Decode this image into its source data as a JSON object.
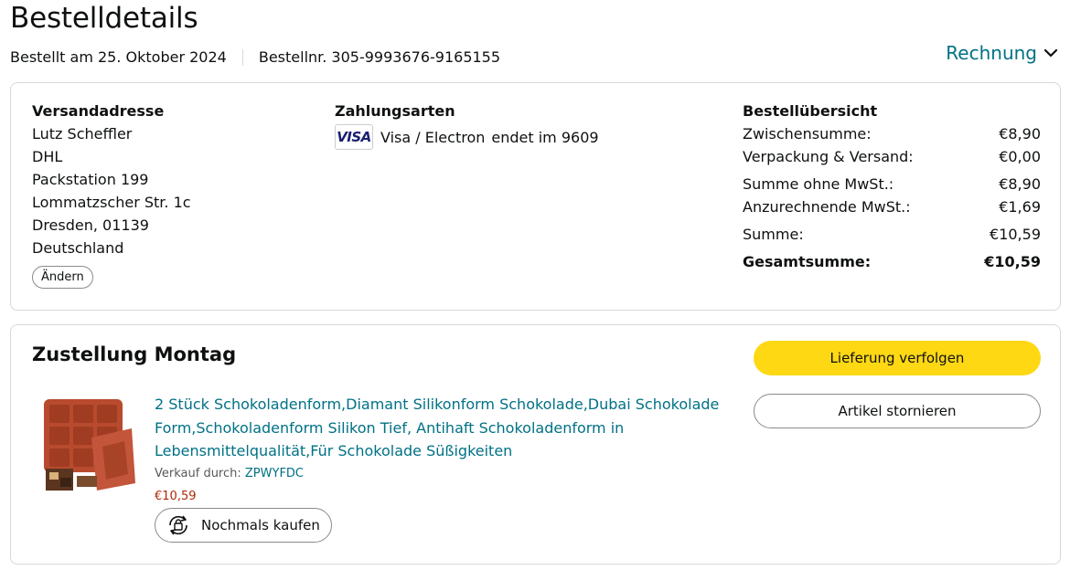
{
  "header": {
    "title": "Bestelldetails",
    "ordered_on": "Bestellt am 25. Oktober 2024",
    "order_number": "Bestellnr. 305-9993676-9165155",
    "invoice_label": "Rechnung"
  },
  "shipping": {
    "title": "Versandadresse",
    "lines": [
      "Lutz Scheffler",
      "DHL",
      "Packstation 199",
      "Lommatzscher Str. 1c",
      "Dresden, 01139",
      "Deutschland"
    ],
    "change_label": "Ändern"
  },
  "payment": {
    "title": "Zahlungsarten",
    "card_brand": "VISA",
    "card_type": "Visa / Electron",
    "ends": "endet im 9609"
  },
  "summary": {
    "title": "Bestellübersicht",
    "rows": [
      {
        "label": "Zwischensumme:",
        "value": "€8,90"
      },
      {
        "label": "Verpackung & Versand:",
        "value": "€0,00"
      },
      {
        "label": "Summe ohne MwSt.:",
        "value": "€8,90"
      },
      {
        "label": "Anzurechnende MwSt.:",
        "value": "€1,69"
      },
      {
        "label": "Summe:",
        "value": "€10,59"
      },
      {
        "label": "Gesamtsumme:",
        "value": "€10,59"
      }
    ]
  },
  "delivery": {
    "title": "Zustellung Montag",
    "track_label": "Lieferung verfolgen",
    "cancel_label": "Artikel stornieren",
    "product": {
      "title": "2 Stück Schokoladenform,Diamant Silikonform Schokolade,Dubai Schokolade Form,Schokoladenform Silikon Tief, Antihaft Schokoladenform in Lebensmittelqualität,Für Schokolade Süßigkeiten",
      "seller_prefix": "Verkauf durch:",
      "seller_name": "ZPWYFDC",
      "price": "€10,59",
      "rebuy_label": "Nochmals kaufen"
    }
  },
  "colors": {
    "link": "#007185",
    "price": "#b12704",
    "primary_button": "#ffd814",
    "border": "#d5d9d9"
  }
}
